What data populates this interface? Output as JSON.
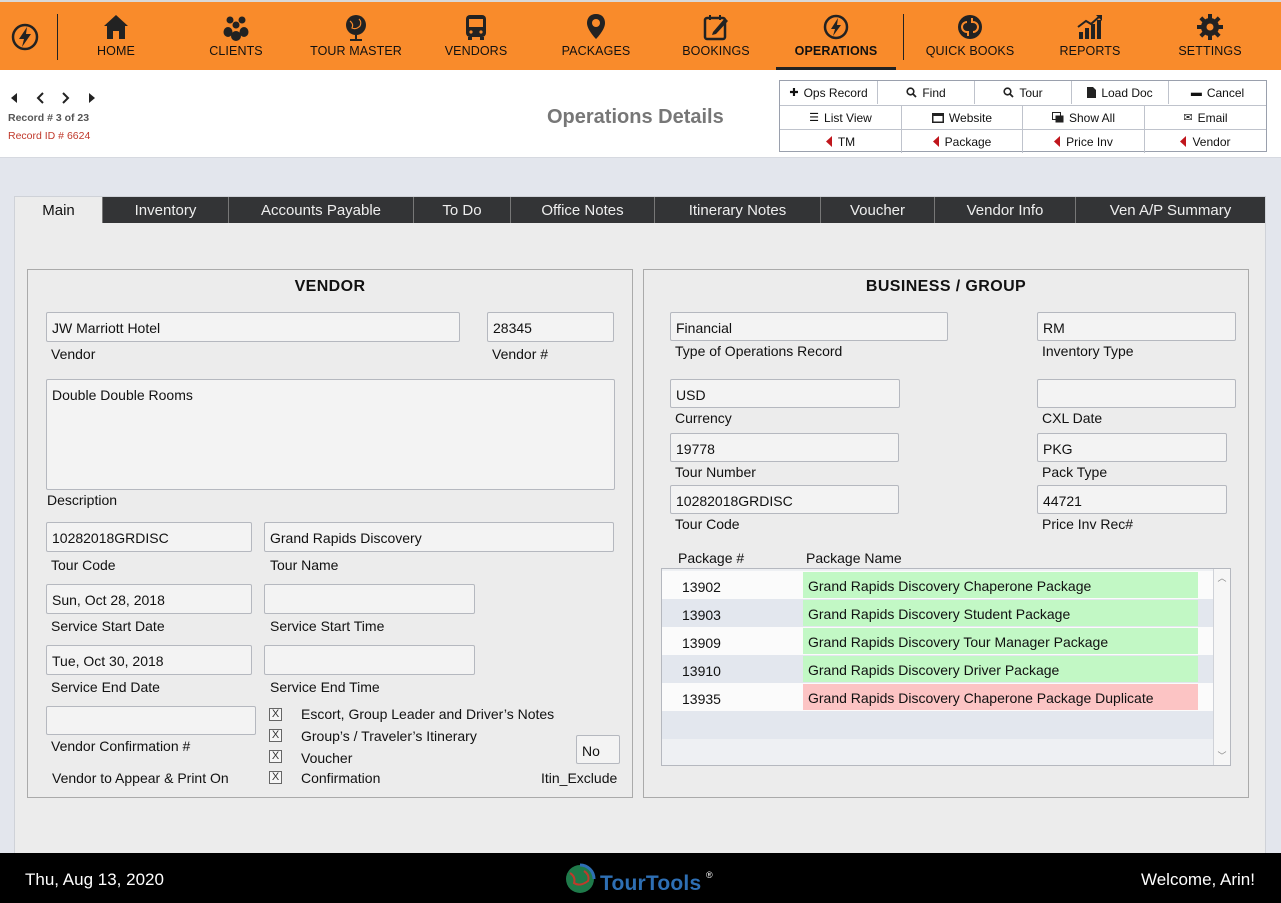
{
  "nav": {
    "items": [
      {
        "label": "HOME",
        "icon": "home-icon"
      },
      {
        "label": "CLIENTS",
        "icon": "clients-icon"
      },
      {
        "label": "TOUR MASTER",
        "icon": "globe-icon"
      },
      {
        "label": "VENDORS",
        "icon": "bus-icon"
      },
      {
        "label": "PACKAGES",
        "icon": "location-pin-icon"
      },
      {
        "label": "BOOKINGS",
        "icon": "booking-edit-icon"
      },
      {
        "label": "OPERATIONS",
        "icon": "bolt-icon"
      },
      {
        "label": "QUICK BOOKS",
        "icon": "quickbooks-icon"
      },
      {
        "label": "REPORTS",
        "icon": "chart-icon"
      },
      {
        "label": "SETTINGS",
        "icon": "gear-icon"
      }
    ],
    "active": "OPERATIONS",
    "accent_color": "#f98b2b"
  },
  "record": {
    "label": "Record # 3 of 23",
    "id_label": "Record ID # 6624"
  },
  "page_title": "Operations Details",
  "toolbar": {
    "row1": [
      "Ops Record",
      "Find",
      "Tour",
      "Load Doc",
      "Cancel"
    ],
    "row2": [
      "List View",
      "Website",
      "Show All",
      "Email"
    ],
    "row3": [
      "TM",
      "Package",
      "Price Inv",
      "Vendor"
    ]
  },
  "tabs": [
    "Main",
    "Inventory",
    "Accounts Payable",
    "To Do",
    "Office Notes",
    "Itinerary Notes",
    "Voucher",
    "Vendor Info",
    "Ven A/P Summary"
  ],
  "active_tab": "Main",
  "vendor": {
    "heading": "VENDOR",
    "vendor_name": "JW Marriott Hotel",
    "vendor_name_label": "Vendor",
    "vendor_num": "28345",
    "vendor_num_label": "Vendor #",
    "description": "Double Double Rooms",
    "description_label": "Description",
    "tour_code": "10282018GRDISC",
    "tour_code_label": "Tour Code",
    "tour_name": "Grand Rapids Discovery",
    "tour_name_label": "Tour Name",
    "service_start_date": "Sun, Oct 28, 2018",
    "service_start_date_label": "Service Start Date",
    "service_start_time": "",
    "service_start_time_label": "Service Start Time",
    "service_end_date": "Tue, Oct 30, 2018",
    "service_end_date_label": "Service End Date",
    "service_end_time": "",
    "service_end_time_label": "Service End Time",
    "confirmation_num": "",
    "confirmation_num_label": "Vendor Confirmation #",
    "appear_label": "Vendor to Appear & Print On",
    "checkboxes": [
      {
        "label": "Escort, Group Leader and Driver’s Notes",
        "checked": "X"
      },
      {
        "label": "Group’s / Traveler’s Itinerary",
        "checked": "X"
      },
      {
        "label": "Voucher",
        "checked": "X"
      },
      {
        "label": "Confirmation",
        "checked": "X"
      }
    ],
    "itin_exclude": "No",
    "itin_exclude_label": "Itin_Exclude"
  },
  "business": {
    "heading": "BUSINESS / GROUP",
    "ops_type": "Financial",
    "ops_type_label": "Type of Operations Record",
    "inventory_type": "RM",
    "inventory_type_label": "Inventory Type",
    "currency": "USD",
    "currency_label": "Currency",
    "cxl_date": "",
    "cxl_date_label": "CXL Date",
    "tour_number": "19778",
    "tour_number_label": "Tour Number",
    "pack_type": "PKG",
    "pack_type_label": "Pack Type",
    "tour_code": "10282018GRDISC",
    "tour_code_label": "Tour Code",
    "price_inv_rec": "44721",
    "price_inv_rec_label": "Price Inv Rec#",
    "packages_header": {
      "num": "Package #",
      "name": "Package Name"
    },
    "packages": [
      {
        "num": "13902",
        "name": "Grand Rapids Discovery Chaperone Package",
        "color": "#c2f8c5"
      },
      {
        "num": "13903",
        "name": "Grand Rapids Discovery Student Package",
        "color": "#c2f8c5"
      },
      {
        "num": "13909",
        "name": "Grand Rapids Discovery Tour Manager Package",
        "color": "#c2f8c5"
      },
      {
        "num": "13910",
        "name": "Grand Rapids Discovery Driver Package",
        "color": "#c2f8c5"
      },
      {
        "num": "13935",
        "name": "Grand Rapids Discovery Chaperone Package Duplicate",
        "color": "#fcc4c4"
      }
    ]
  },
  "footer": {
    "date": "Thu, Aug 13, 2020",
    "brand": "TourTools",
    "registered": "®",
    "welcome": "Welcome, Arin!"
  }
}
